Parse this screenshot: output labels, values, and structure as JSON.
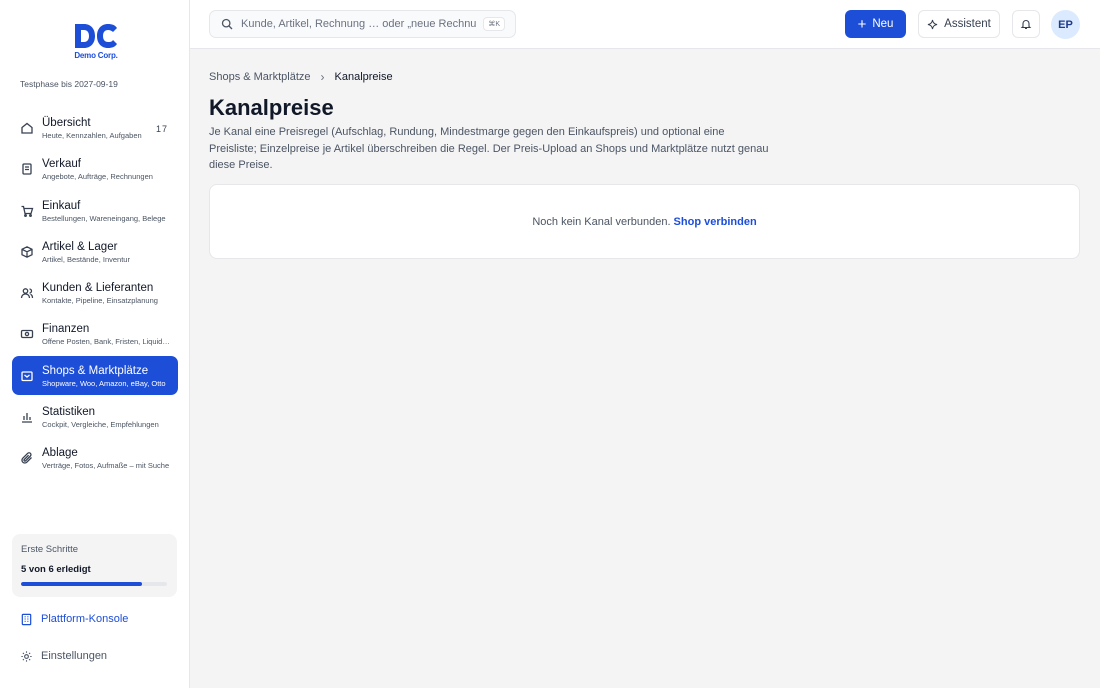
{
  "brand": {
    "logo_text": "DC",
    "name": "Demo Corp.",
    "trial": "Testphase bis 2027-09-19",
    "accent": "#1d4ed8"
  },
  "sidebar": {
    "items": [
      {
        "icon": "home-icon",
        "title": "Übersicht",
        "subtitle": "Heute, Kennzahlen, Aufgaben",
        "badge": "17"
      },
      {
        "icon": "receipt-icon",
        "title": "Verkauf",
        "subtitle": "Angebote, Aufträge, Rechnungen"
      },
      {
        "icon": "cart-icon",
        "title": "Einkauf",
        "subtitle": "Bestellungen, Wareneingang, Belege"
      },
      {
        "icon": "box-icon",
        "title": "Artikel & Lager",
        "subtitle": "Artikel, Bestände, Inventur"
      },
      {
        "icon": "users-icon",
        "title": "Kunden & Lieferanten",
        "subtitle": "Kontakte, Pipeline, Einsatzplanung"
      },
      {
        "icon": "banknote-icon",
        "title": "Finanzen",
        "subtitle": "Offene Posten, Bank, Fristen, Liquidität"
      },
      {
        "icon": "store-icon",
        "title": "Shops & Marktplätze",
        "subtitle": "Shopware, Woo, Amazon, eBay, Otto",
        "active": true
      },
      {
        "icon": "bar-chart-icon",
        "title": "Statistiken",
        "subtitle": "Cockpit, Vergleiche, Empfehlungen"
      },
      {
        "icon": "paperclip-icon",
        "title": "Ablage",
        "subtitle": "Verträge, Fotos, Aufmaße – mit Suche"
      }
    ],
    "progress": {
      "title": "Erste Schritte",
      "status": "5 von 6 erledigt",
      "fraction": 0.83
    },
    "platform_link": "Plattform-Konsole",
    "settings_link": "Einstellungen"
  },
  "topbar": {
    "search_placeholder": "Kunde, Artikel, Rechnung … oder „neue Rechnung“",
    "search_shortcut": "⌘K",
    "new_label": "Neu",
    "assistant_label": "Assistent",
    "avatar_initials": "EP"
  },
  "main": {
    "breadcrumb": [
      "Shops & Marktplätze",
      "Kanalpreise"
    ],
    "title": "Kanalpreise",
    "description": "Je Kanal eine Preisregel (Aufschlag, Rundung, Mindestmarge gegen den Einkaufspreis) und optional eine Preisliste; Einzelpreise je Artikel überschreiben die Regel. Der Preis-Upload an Shops und Marktplätze nutzt genau diese Preise.",
    "empty_text": "Noch kein Kanal verbunden.",
    "empty_link": "Shop verbinden"
  }
}
